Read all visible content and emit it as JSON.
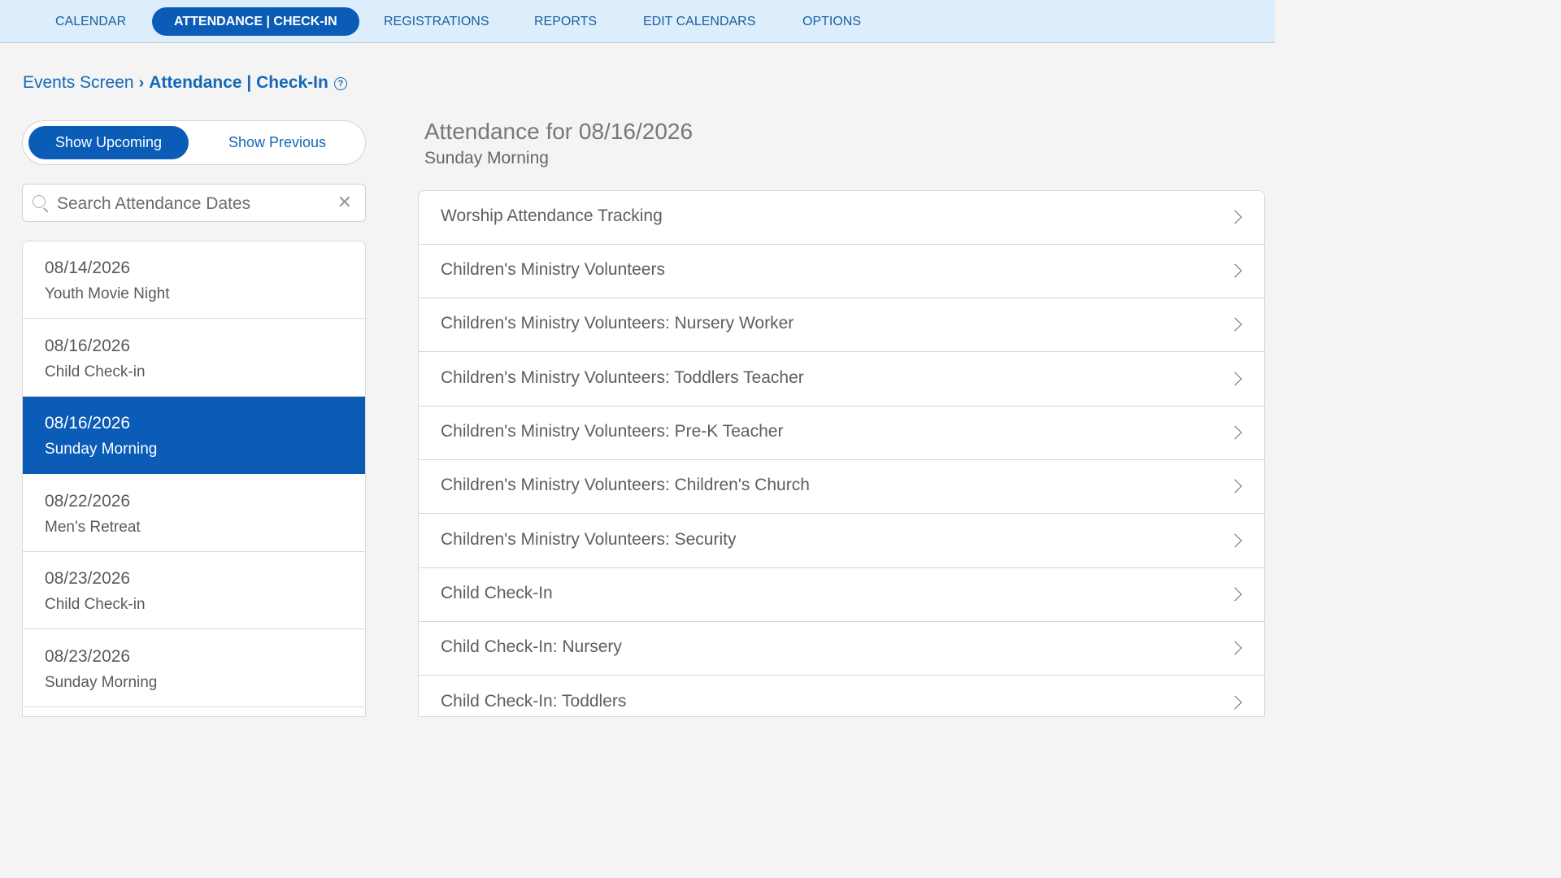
{
  "nav": {
    "items": [
      {
        "label": "CALENDAR"
      },
      {
        "label": "ATTENDANCE | CHECK-IN"
      },
      {
        "label": "REGISTRATIONS"
      },
      {
        "label": "REPORTS"
      },
      {
        "label": "EDIT CALENDARS"
      },
      {
        "label": "OPTIONS"
      }
    ],
    "active_index": 1,
    "active_color": "#0a5cb7"
  },
  "breadcrumb": {
    "parent": "Events Screen",
    "current": "Attendance | Check-In",
    "help_icon": "question-circle-icon"
  },
  "toggle": {
    "upcoming_label": "Show Upcoming",
    "previous_label": "Show Previous",
    "selected": "upcoming"
  },
  "search": {
    "placeholder": "Search Attendance Dates",
    "value": ""
  },
  "dates": [
    {
      "date": "08/14/2026",
      "name": "Youth Movie Night",
      "selected": false
    },
    {
      "date": "08/16/2026",
      "name": "Child Check-in",
      "selected": false
    },
    {
      "date": "08/16/2026",
      "name": "Sunday Morning",
      "selected": true
    },
    {
      "date": "08/22/2026",
      "name": "Men's Retreat",
      "selected": false
    },
    {
      "date": "08/23/2026",
      "name": "Child Check-in",
      "selected": false
    },
    {
      "date": "08/23/2026",
      "name": "Sunday Morning",
      "selected": false
    }
  ],
  "attendance": {
    "title": "Attendance for 08/16/2026",
    "subtitle": "Sunday Morning",
    "groups": [
      {
        "label": "Worship Attendance Tracking"
      },
      {
        "label": "Children's Ministry Volunteers"
      },
      {
        "label": "Children's Ministry Volunteers: Nursery Worker"
      },
      {
        "label": "Children's Ministry Volunteers: Toddlers Teacher"
      },
      {
        "label": "Children's Ministry Volunteers: Pre-K Teacher"
      },
      {
        "label": "Children's Ministry Volunteers: Children's Church"
      },
      {
        "label": "Children's Ministry Volunteers: Security"
      },
      {
        "label": "Child Check-In"
      },
      {
        "label": "Child Check-In: Nursery"
      },
      {
        "label": "Child Check-In: Toddlers"
      }
    ]
  }
}
